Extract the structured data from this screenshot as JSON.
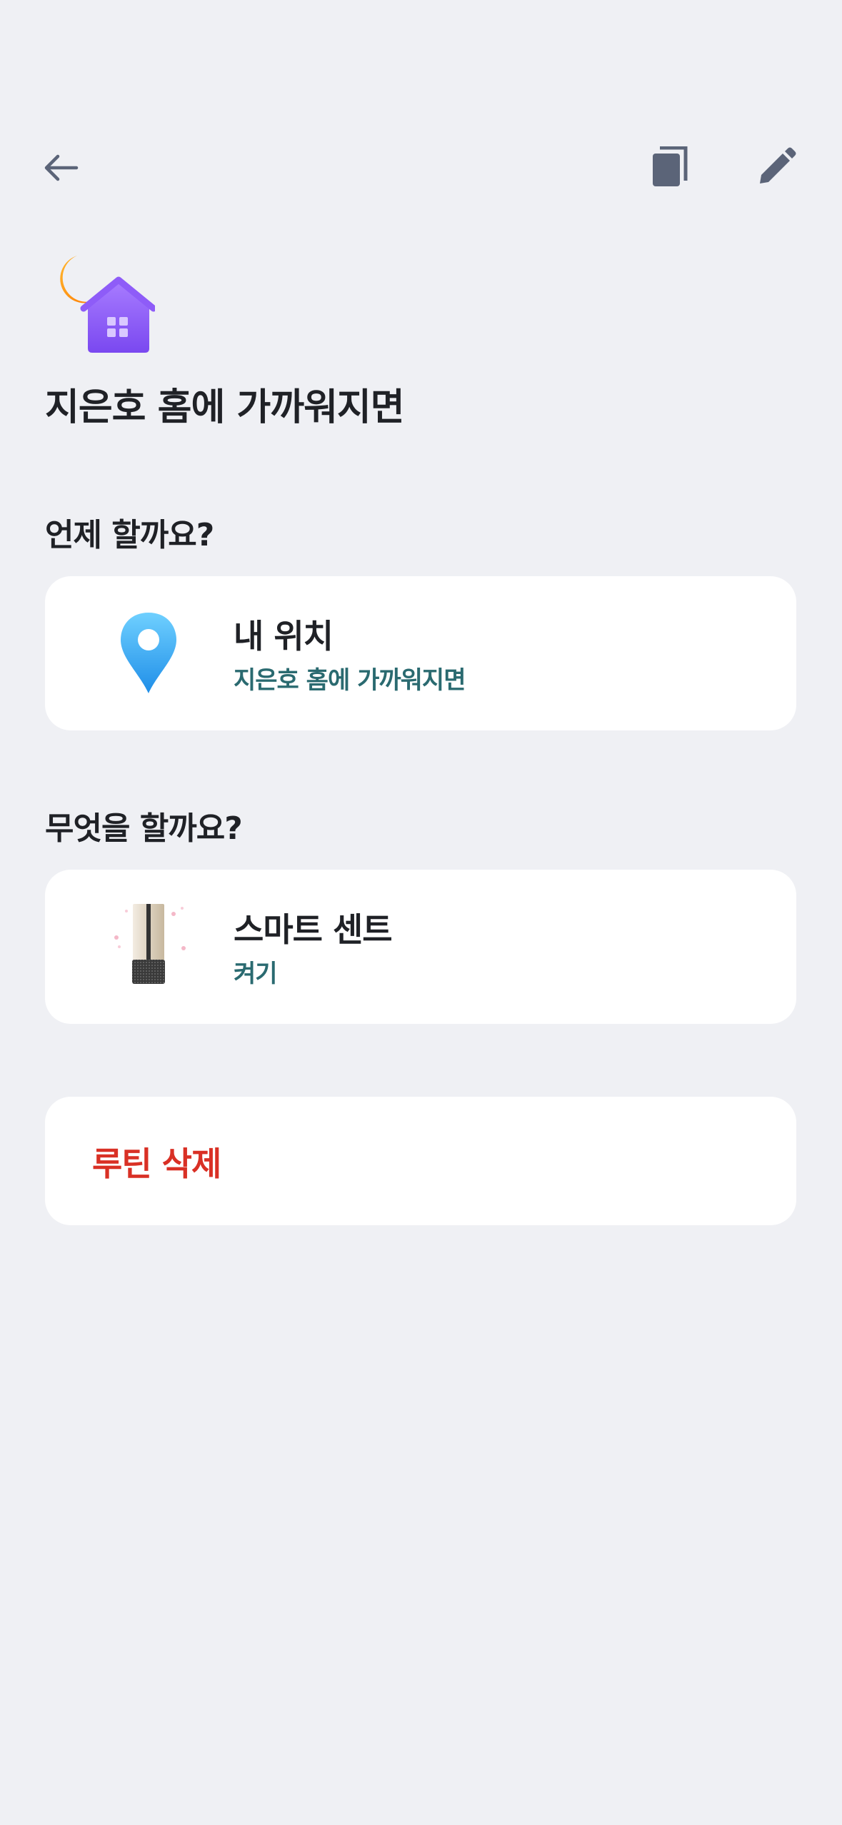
{
  "header": {
    "back_icon": "arrow-left-icon",
    "copy_icon": "copy-icon",
    "edit_icon": "pencil-icon",
    "icon_color": "#5b6478"
  },
  "routine": {
    "icon": "moon-and-house-icon",
    "title": "지은호 홈에 가까워지면"
  },
  "when": {
    "label": "언제 할까요?",
    "condition": {
      "icon": "location-pin-icon",
      "title": "내 위치",
      "subtitle": "지은호 홈에 가까워지면"
    }
  },
  "what": {
    "label": "무엇을 할까요?",
    "action": {
      "icon": "smart-scent-device-icon",
      "title": "스마트 센트",
      "subtitle": "켜기"
    }
  },
  "delete": {
    "label": "루틴 삭제",
    "color": "#d93025"
  },
  "colors": {
    "background": "#eff0f4",
    "card": "#ffffff",
    "subtitle": "#2a6a70"
  }
}
